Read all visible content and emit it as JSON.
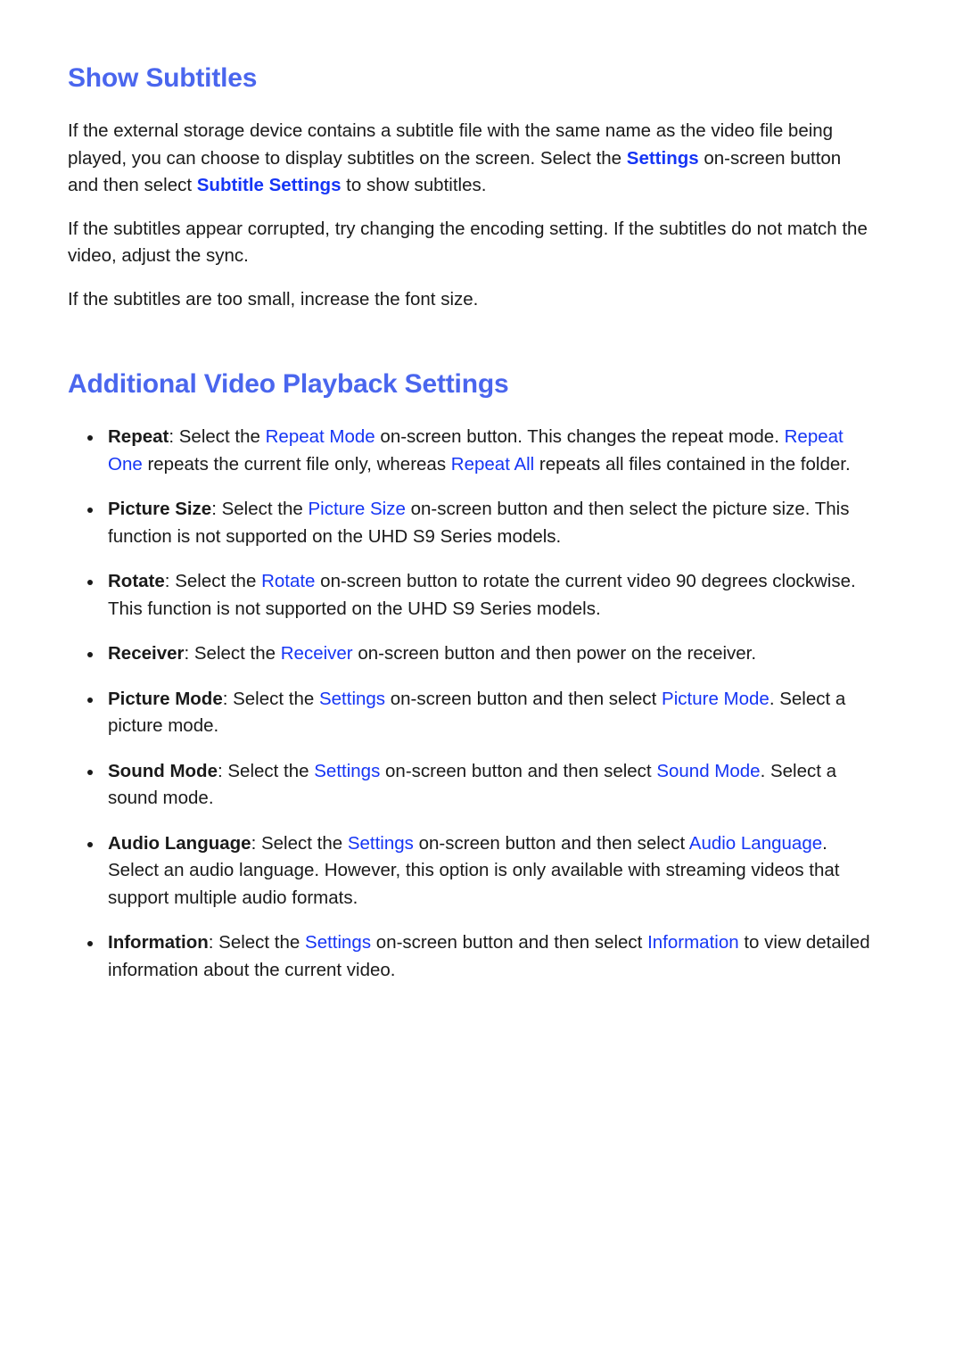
{
  "document": {
    "sections": [
      {
        "id": "show-subtitles",
        "heading": "Show Subtitles",
        "paragraphs": [
          {
            "id": "p1",
            "runs": [
              {
                "text": "If the external storage device contains a subtitle file with the same name as the video file being played, you can choose to display subtitles on the screen. Select the ",
                "style": "plain"
              },
              {
                "text": "Settings",
                "style": "ui-b"
              },
              {
                "text": " on-screen button and then select ",
                "style": "plain"
              },
              {
                "text": "Subtitle Settings",
                "style": "ui-b"
              },
              {
                "text": " to show subtitles.",
                "style": "plain"
              }
            ]
          },
          {
            "id": "p2",
            "runs": [
              {
                "text": "If the subtitles appear corrupted, try changing the encoding setting. If the subtitles do not match the video, adjust the sync.",
                "style": "plain"
              }
            ]
          },
          {
            "id": "p3",
            "runs": [
              {
                "text": "If the subtitles are too small, increase the font size.",
                "style": "plain"
              }
            ]
          }
        ]
      },
      {
        "id": "additional-video-playback-settings",
        "heading": "Additional Video Playback Settings",
        "bullets": [
          {
            "id": "bullet-repeat",
            "runs": [
              {
                "text": "Repeat",
                "style": "term"
              },
              {
                "text": ": Select the ",
                "style": "plain"
              },
              {
                "text": "Repeat Mode",
                "style": "ui"
              },
              {
                "text": " on-screen button. This changes the repeat mode. ",
                "style": "plain"
              },
              {
                "text": "Repeat One",
                "style": "ui"
              },
              {
                "text": " repeats the current file only, whereas ",
                "style": "plain"
              },
              {
                "text": "Repeat All",
                "style": "ui"
              },
              {
                "text": " repeats all files contained in the folder.",
                "style": "plain"
              }
            ]
          },
          {
            "id": "bullet-picture-size",
            "runs": [
              {
                "text": "Picture Size",
                "style": "term"
              },
              {
                "text": ": Select the ",
                "style": "plain"
              },
              {
                "text": "Picture Size",
                "style": "ui"
              },
              {
                "text": " on-screen button and then select the picture size. This function is not supported on the UHD S9 Series models.",
                "style": "plain"
              }
            ]
          },
          {
            "id": "bullet-rotate",
            "runs": [
              {
                "text": "Rotate",
                "style": "term"
              },
              {
                "text": ": Select the ",
                "style": "plain"
              },
              {
                "text": "Rotate",
                "style": "ui"
              },
              {
                "text": " on-screen button to rotate the current video 90 degrees clockwise. This function is not supported on the UHD S9 Series models.",
                "style": "plain"
              }
            ]
          },
          {
            "id": "bullet-receiver",
            "runs": [
              {
                "text": "Receiver",
                "style": "term"
              },
              {
                "text": ": Select the ",
                "style": "plain"
              },
              {
                "text": "Receiver",
                "style": "ui"
              },
              {
                "text": " on-screen button and then power on the receiver.",
                "style": "plain"
              }
            ]
          },
          {
            "id": "bullet-picture-mode",
            "runs": [
              {
                "text": "Picture Mode",
                "style": "term"
              },
              {
                "text": ": Select the ",
                "style": "plain"
              },
              {
                "text": "Settings",
                "style": "ui"
              },
              {
                "text": " on-screen button and then select ",
                "style": "plain"
              },
              {
                "text": "Picture Mode",
                "style": "ui"
              },
              {
                "text": ". Select a picture mode.",
                "style": "plain"
              }
            ]
          },
          {
            "id": "bullet-sound-mode",
            "runs": [
              {
                "text": "Sound Mode",
                "style": "term"
              },
              {
                "text": ": Select the ",
                "style": "plain"
              },
              {
                "text": "Settings",
                "style": "ui"
              },
              {
                "text": " on-screen button and then select ",
                "style": "plain"
              },
              {
                "text": "Sound Mode",
                "style": "ui"
              },
              {
                "text": ". Select a sound mode.",
                "style": "plain"
              }
            ]
          },
          {
            "id": "bullet-audio-language",
            "runs": [
              {
                "text": "Audio Language",
                "style": "term"
              },
              {
                "text": ": Select the ",
                "style": "plain"
              },
              {
                "text": "Settings",
                "style": "ui"
              },
              {
                "text": " on-screen button and then select ",
                "style": "plain"
              },
              {
                "text": "Audio Language",
                "style": "ui"
              },
              {
                "text": ". Select an audio language. However, this option is only available with streaming videos that support multiple audio formats.",
                "style": "plain"
              }
            ]
          },
          {
            "id": "bullet-information",
            "runs": [
              {
                "text": "Information",
                "style": "term"
              },
              {
                "text": ": Select the ",
                "style": "plain"
              },
              {
                "text": "Settings",
                "style": "ui"
              },
              {
                "text": " on-screen button and then select ",
                "style": "plain"
              },
              {
                "text": "Information",
                "style": "ui"
              },
              {
                "text": " to view detailed information about the current video.",
                "style": "plain"
              }
            ]
          }
        ]
      }
    ]
  },
  "colors": {
    "heading_blue": "#4a66ee",
    "inline_term_blue": "#1535f5",
    "body_text": "#1a1a1a",
    "page_background": "#ffffff"
  }
}
